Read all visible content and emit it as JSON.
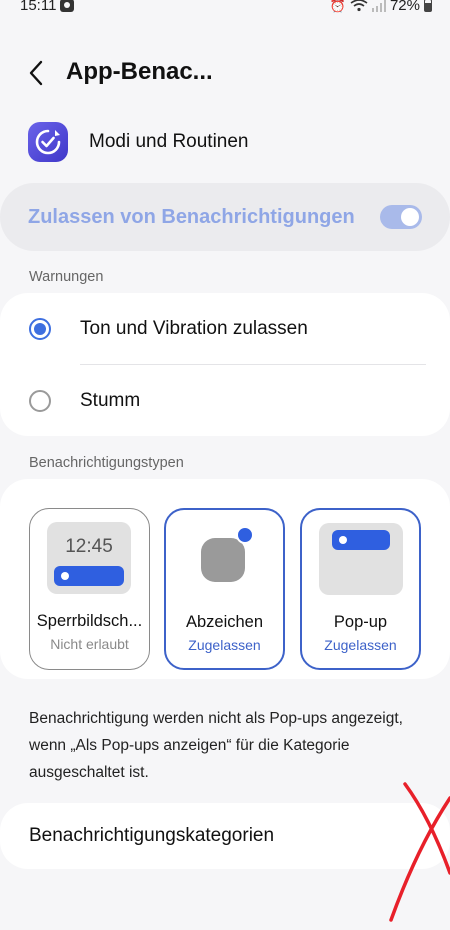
{
  "status_bar": {
    "time": "15:11",
    "battery": "72%"
  },
  "header": {
    "title": "App-Benac..."
  },
  "app": {
    "name": "Modi und Routinen"
  },
  "master_toggle": {
    "label": "Zulassen von Benachrichtigungen",
    "enabled": true
  },
  "alerts": {
    "section_label": "Warnungen",
    "options": [
      {
        "label": "Ton und Vibration zulassen",
        "selected": true
      },
      {
        "label": "Stumm",
        "selected": false
      }
    ]
  },
  "notification_types": {
    "section_label": "Benachrichtigungstypen",
    "tiles": [
      {
        "name": "Sperrbildsch...",
        "status": "Nicht erlaubt",
        "preview_time": "12:45"
      },
      {
        "name": "Abzeichen",
        "status": "Zugelassen"
      },
      {
        "name": "Pop-up",
        "status": "Zugelassen"
      }
    ]
  },
  "info_text": "Benachrichtigung werden nicht als Pop-ups angezeigt, wenn „Als Pop-ups anzeigen“ für die Kategorie ausgeschaltet ist.",
  "categories_row": {
    "label": "Benachrichtigungskategorien"
  },
  "colors": {
    "accent": "#3d62c9",
    "toggle_track": "#a9baea",
    "master_label": "#8fa6e6",
    "annotation": "#e8202a"
  }
}
